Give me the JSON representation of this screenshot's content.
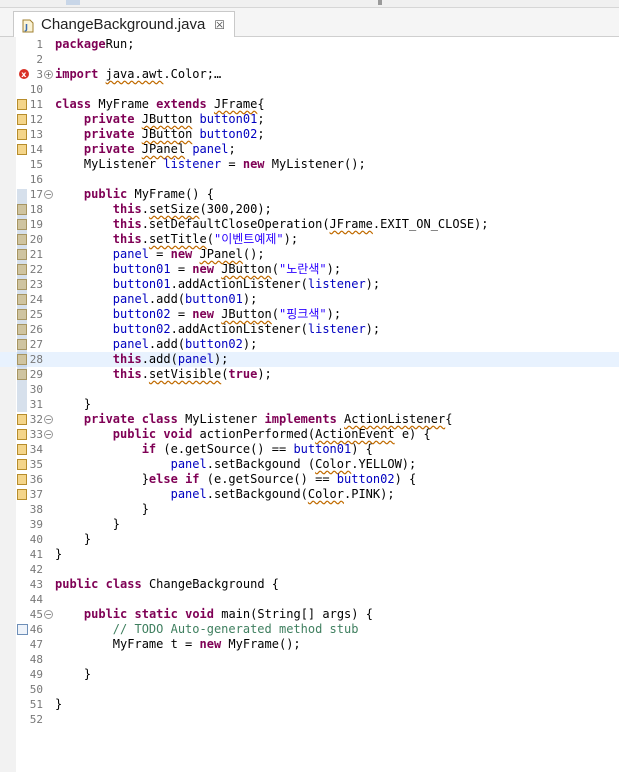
{
  "tab": {
    "title": "ChangeBackground.java",
    "close_glyph": "☒",
    "icon": "java-file-icon"
  },
  "colors": {
    "keyword": "#7f0055",
    "field": "#0000c0",
    "string": "#2a00ff",
    "comment": "#3f7f5f"
  },
  "lines": [
    {
      "n": "1",
      "parts": [
        [
          "kw",
          "package"
        ],
        [
          "",
          "Run;"
        ]
      ]
    },
    {
      "n": "2",
      "parts": []
    },
    {
      "n": "3",
      "fold": "plus",
      "err": true,
      "parts": [
        [
          "kw",
          "import"
        ],
        [
          "",
          " "
        ],
        [
          "u",
          "java.awt"
        ],
        [
          "",
          ".Color;"
        ],
        [
          "",
          "…"
        ]
      ]
    },
    {
      "n": "10",
      "parts": []
    },
    {
      "n": "11",
      "warn": true,
      "parts": [
        [
          "kw",
          "class"
        ],
        [
          "",
          " MyFrame "
        ],
        [
          "kw",
          "extends"
        ],
        [
          "",
          " "
        ],
        [
          "u",
          "JFrame"
        ],
        [
          "",
          "{"
        ]
      ]
    },
    {
      "n": "12",
      "warn": true,
      "parts": [
        [
          "",
          "    "
        ],
        [
          "kw",
          "private"
        ],
        [
          "",
          " "
        ],
        [
          "u",
          "JButton"
        ],
        [
          "",
          " "
        ],
        [
          "fld",
          "button01"
        ],
        [
          "",
          ";"
        ]
      ]
    },
    {
      "n": "13",
      "warn": true,
      "parts": [
        [
          "",
          "    "
        ],
        [
          "kw",
          "private"
        ],
        [
          "",
          " "
        ],
        [
          "u",
          "JButton"
        ],
        [
          "",
          " "
        ],
        [
          "fld",
          "button02"
        ],
        [
          "",
          ";"
        ]
      ]
    },
    {
      "n": "14",
      "warn": true,
      "parts": [
        [
          "",
          "    "
        ],
        [
          "kw",
          "private"
        ],
        [
          "",
          " "
        ],
        [
          "u",
          "JPanel"
        ],
        [
          "",
          " "
        ],
        [
          "fld",
          "panel"
        ],
        [
          "",
          ";"
        ]
      ]
    },
    {
      "n": "15",
      "parts": [
        [
          "",
          "    MyListener "
        ],
        [
          "fld",
          "listener"
        ],
        [
          "",
          " = "
        ],
        [
          "kw",
          "new"
        ],
        [
          "",
          " MyListener();"
        ]
      ]
    },
    {
      "n": "16",
      "parts": []
    },
    {
      "n": "17",
      "fold": "minus",
      "parts": [
        [
          "",
          "    "
        ],
        [
          "kw",
          "public"
        ],
        [
          "",
          " MyFrame() {"
        ]
      ]
    },
    {
      "n": "18",
      "warn": true,
      "parts": [
        [
          "",
          "        "
        ],
        [
          "kw",
          "this"
        ],
        [
          "",
          "."
        ],
        [
          "u",
          "setSize"
        ],
        [
          "",
          "(300,200);"
        ]
      ]
    },
    {
      "n": "19",
      "warn": true,
      "parts": [
        [
          "",
          "        "
        ],
        [
          "kw",
          "this"
        ],
        [
          "",
          ".setDefaultCloseOperation("
        ],
        [
          "u",
          "JFrame"
        ],
        [
          "",
          ".EXIT_ON_CLOSE);"
        ]
      ]
    },
    {
      "n": "20",
      "warn": true,
      "parts": [
        [
          "",
          "        "
        ],
        [
          "kw",
          "this"
        ],
        [
          "",
          "."
        ],
        [
          "u",
          "setTitle"
        ],
        [
          "",
          "("
        ],
        [
          "str",
          "\"이벤트예제\""
        ],
        [
          "",
          ");"
        ]
      ]
    },
    {
      "n": "21",
      "warn": true,
      "parts": [
        [
          "",
          "        "
        ],
        [
          "fld",
          "panel"
        ],
        [
          "",
          " = "
        ],
        [
          "kw",
          "new"
        ],
        [
          "",
          " "
        ],
        [
          "u",
          "JPanel"
        ],
        [
          "",
          "();"
        ]
      ]
    },
    {
      "n": "22",
      "warn": true,
      "parts": [
        [
          "",
          "        "
        ],
        [
          "fld",
          "button01"
        ],
        [
          "",
          " = "
        ],
        [
          "kw",
          "new"
        ],
        [
          "",
          " "
        ],
        [
          "u",
          "JButton"
        ],
        [
          "",
          "("
        ],
        [
          "str",
          "\"노란색\""
        ],
        [
          "",
          ");"
        ]
      ]
    },
    {
      "n": "23",
      "warn": true,
      "parts": [
        [
          "",
          "        "
        ],
        [
          "fld",
          "button01"
        ],
        [
          "",
          ".addActionListener("
        ],
        [
          "fld",
          "listener"
        ],
        [
          "",
          ");"
        ]
      ]
    },
    {
      "n": "24",
      "warn": true,
      "parts": [
        [
          "",
          "        "
        ],
        [
          "fld",
          "panel"
        ],
        [
          "",
          ".add("
        ],
        [
          "fld",
          "button01"
        ],
        [
          "",
          ");"
        ]
      ]
    },
    {
      "n": "25",
      "warn": true,
      "parts": [
        [
          "",
          "        "
        ],
        [
          "fld",
          "button02"
        ],
        [
          "",
          " = "
        ],
        [
          "kw",
          "new"
        ],
        [
          "",
          " "
        ],
        [
          "u",
          "JButton"
        ],
        [
          "",
          "("
        ],
        [
          "str",
          "\"핑크색\""
        ],
        [
          "",
          ");"
        ]
      ]
    },
    {
      "n": "26",
      "warn": true,
      "parts": [
        [
          "",
          "        "
        ],
        [
          "fld",
          "button02"
        ],
        [
          "",
          ".addActionListener("
        ],
        [
          "fld",
          "listener"
        ],
        [
          "",
          ");"
        ]
      ]
    },
    {
      "n": "27",
      "warn": true,
      "parts": [
        [
          "",
          "        "
        ],
        [
          "fld",
          "panel"
        ],
        [
          "",
          ".add("
        ],
        [
          "fld",
          "button02"
        ],
        [
          "",
          ");"
        ]
      ]
    },
    {
      "n": "28",
      "warn": true,
      "current": true,
      "parts": [
        [
          "",
          "        "
        ],
        [
          "kw",
          "this"
        ],
        [
          "",
          ".add("
        ],
        [
          "fld",
          "panel"
        ],
        [
          "",
          ");"
        ]
      ]
    },
    {
      "n": "29",
      "warn": true,
      "parts": [
        [
          "",
          "        "
        ],
        [
          "kw",
          "this"
        ],
        [
          "",
          "."
        ],
        [
          "u",
          "setVisible"
        ],
        [
          "",
          "("
        ],
        [
          "kw",
          "true"
        ],
        [
          "",
          ");"
        ]
      ]
    },
    {
      "n": "30",
      "parts": []
    },
    {
      "n": "31",
      "parts": [
        [
          "",
          "    }"
        ]
      ]
    },
    {
      "n": "32",
      "fold": "minus",
      "warn": true,
      "parts": [
        [
          "",
          "    "
        ],
        [
          "kw",
          "private"
        ],
        [
          "",
          " "
        ],
        [
          "kw",
          "class"
        ],
        [
          "",
          " MyListener "
        ],
        [
          "kw",
          "implements"
        ],
        [
          "",
          " "
        ],
        [
          "u",
          "ActionListener"
        ],
        [
          "",
          "{"
        ]
      ]
    },
    {
      "n": "33",
      "fold": "minus",
      "warn": true,
      "parts": [
        [
          "",
          "        "
        ],
        [
          "kw",
          "public"
        ],
        [
          "",
          " "
        ],
        [
          "kw",
          "void"
        ],
        [
          "",
          " actionPerformed("
        ],
        [
          "u",
          "ActionEvent"
        ],
        [
          "",
          " e) {"
        ]
      ]
    },
    {
      "n": "34",
      "warn": true,
      "parts": [
        [
          "",
          "            "
        ],
        [
          "kw",
          "if"
        ],
        [
          "",
          " (e.getSource() == "
        ],
        [
          "fld",
          "button01"
        ],
        [
          "",
          ") {"
        ]
      ]
    },
    {
      "n": "35",
      "warn": true,
      "parts": [
        [
          "",
          "                "
        ],
        [
          "fld",
          "panel"
        ],
        [
          "",
          ".setBackgound ("
        ],
        [
          "u",
          "Color"
        ],
        [
          "",
          ".YELLOW);"
        ]
      ]
    },
    {
      "n": "36",
      "warn": true,
      "parts": [
        [
          "",
          "            }"
        ],
        [
          "kw",
          "else"
        ],
        [
          "",
          " "
        ],
        [
          "kw",
          "if"
        ],
        [
          "",
          " (e.getSource() == "
        ],
        [
          "fld",
          "button02"
        ],
        [
          "",
          ") {"
        ]
      ]
    },
    {
      "n": "37",
      "warn": true,
      "parts": [
        [
          "",
          "                "
        ],
        [
          "fld",
          "panel"
        ],
        [
          "",
          ".setBackgound("
        ],
        [
          "u",
          "Color"
        ],
        [
          "",
          ".PINK);"
        ]
      ]
    },
    {
      "n": "38",
      "parts": [
        [
          "",
          "            }"
        ]
      ]
    },
    {
      "n": "39",
      "parts": [
        [
          "",
          "        }"
        ]
      ]
    },
    {
      "n": "40",
      "parts": [
        [
          "",
          "    }"
        ]
      ]
    },
    {
      "n": "41",
      "parts": [
        [
          "",
          "}"
        ]
      ]
    },
    {
      "n": "42",
      "parts": []
    },
    {
      "n": "43",
      "parts": [
        [
          "kw",
          "public"
        ],
        [
          "",
          " "
        ],
        [
          "kw",
          "class"
        ],
        [
          "",
          " ChangeBackground {"
        ]
      ]
    },
    {
      "n": "44",
      "parts": []
    },
    {
      "n": "45",
      "fold": "minus",
      "parts": [
        [
          "",
          "    "
        ],
        [
          "kw",
          "public"
        ],
        [
          "",
          " "
        ],
        [
          "kw",
          "static"
        ],
        [
          "",
          " "
        ],
        [
          "kw",
          "void"
        ],
        [
          "",
          " main(String[] args) {"
        ]
      ]
    },
    {
      "n": "46",
      "todo": true,
      "parts": [
        [
          "",
          "        "
        ],
        [
          "cmt",
          "// TODO Auto-generated method stub"
        ]
      ]
    },
    {
      "n": "47",
      "parts": [
        [
          "",
          "        MyFrame t = "
        ],
        [
          "kw",
          "new"
        ],
        [
          "",
          " MyFrame();"
        ]
      ]
    },
    {
      "n": "48",
      "parts": []
    },
    {
      "n": "49",
      "parts": [
        [
          "",
          "    }"
        ]
      ]
    },
    {
      "n": "50",
      "parts": []
    },
    {
      "n": "51",
      "parts": [
        [
          "",
          "}"
        ]
      ]
    },
    {
      "n": "52",
      "parts": []
    }
  ]
}
